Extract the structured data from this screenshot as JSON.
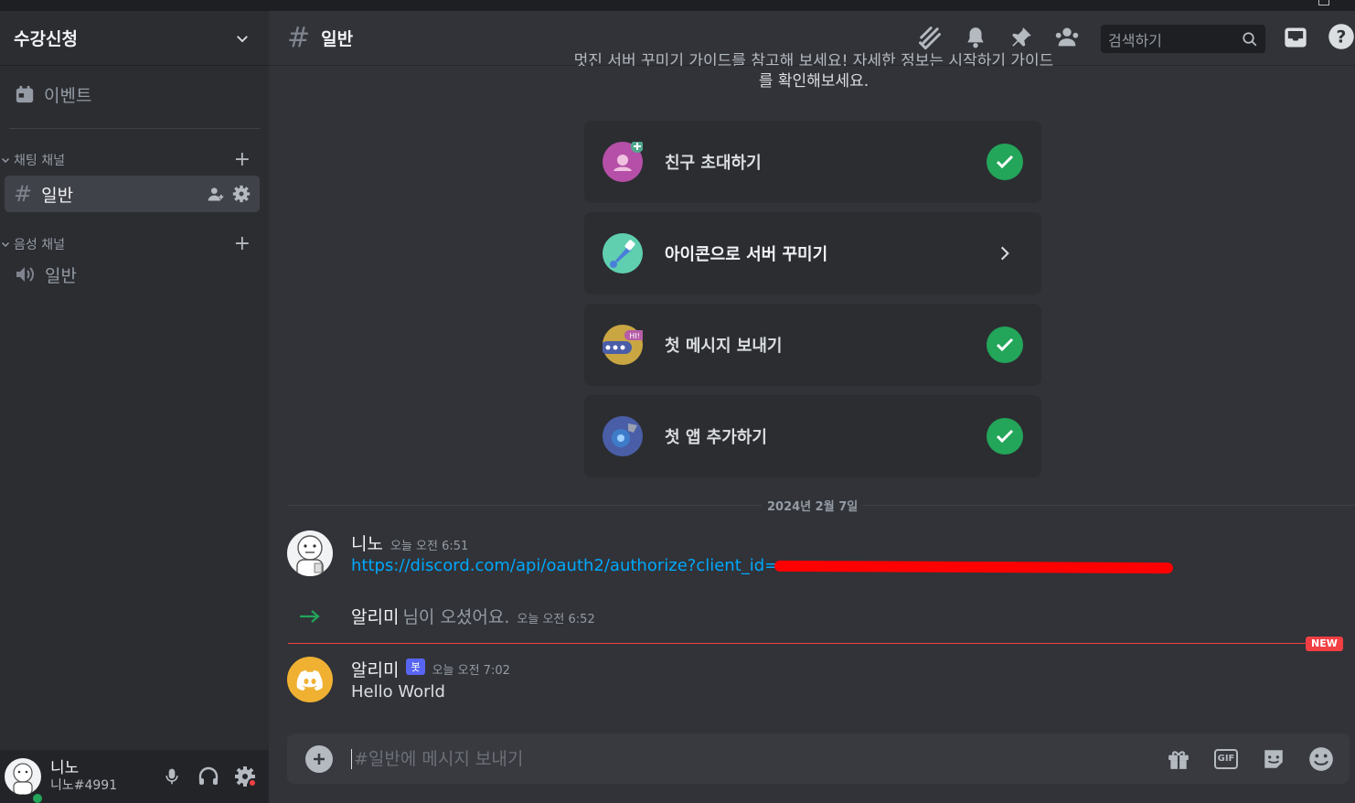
{
  "server": {
    "name": "수강신청"
  },
  "sidebar": {
    "events_label": "이벤트",
    "categories": [
      {
        "label": "채팅 채널",
        "channels": [
          {
            "name": "일반",
            "type": "text",
            "active": true
          }
        ]
      },
      {
        "label": "음성 채널",
        "channels": [
          {
            "name": "일반",
            "type": "voice",
            "active": false
          }
        ]
      }
    ]
  },
  "user": {
    "name": "니노",
    "tag": "니노#4991",
    "status": "online"
  },
  "header": {
    "channel": "일반",
    "search_placeholder": "검색하기",
    "icons": [
      "threads-icon",
      "bell-icon",
      "pin-icon",
      "members-icon",
      "inbox-icon",
      "help-icon"
    ]
  },
  "intro": {
    "line1": "멋진 서버 꾸미기 가이드를 참고해 보세요! 자세한 정보는 시작하기 가이드",
    "line1_link": "시작하기 가이드",
    "line2": "를 확인해보세요."
  },
  "checklist": [
    {
      "label": "친구 초대하기",
      "done": true
    },
    {
      "label": "아이콘으로 서버 꾸미기",
      "done": false
    },
    {
      "label": "첫 메시지 보내기",
      "done": true
    },
    {
      "label": "첫 앱 추가하기",
      "done": true
    }
  ],
  "date_divider": "2024년 2월 7일",
  "messages": [
    {
      "author": "니노",
      "time": "오늘 오전 6:51",
      "content": "https://discord.com/api/oauth2/authorize?client_id="
    },
    {
      "system_author": "알리미",
      "system_text": "님이 오셨어요.",
      "time": "오늘 오전 6:52"
    },
    {
      "author": "알리미",
      "bot_label": "봇",
      "time": "오늘 오전 7:02",
      "content": "Hello World"
    }
  ],
  "new_badge": "NEW",
  "composer": {
    "placeholder": "#일반에 메시지 보내기",
    "gif_label": "GIF"
  },
  "colors": {
    "accent": "#5865f2",
    "online": "#23a55a",
    "new": "#f23f43",
    "link": "#00a8fc",
    "bot_avatar": "#f0b132"
  }
}
